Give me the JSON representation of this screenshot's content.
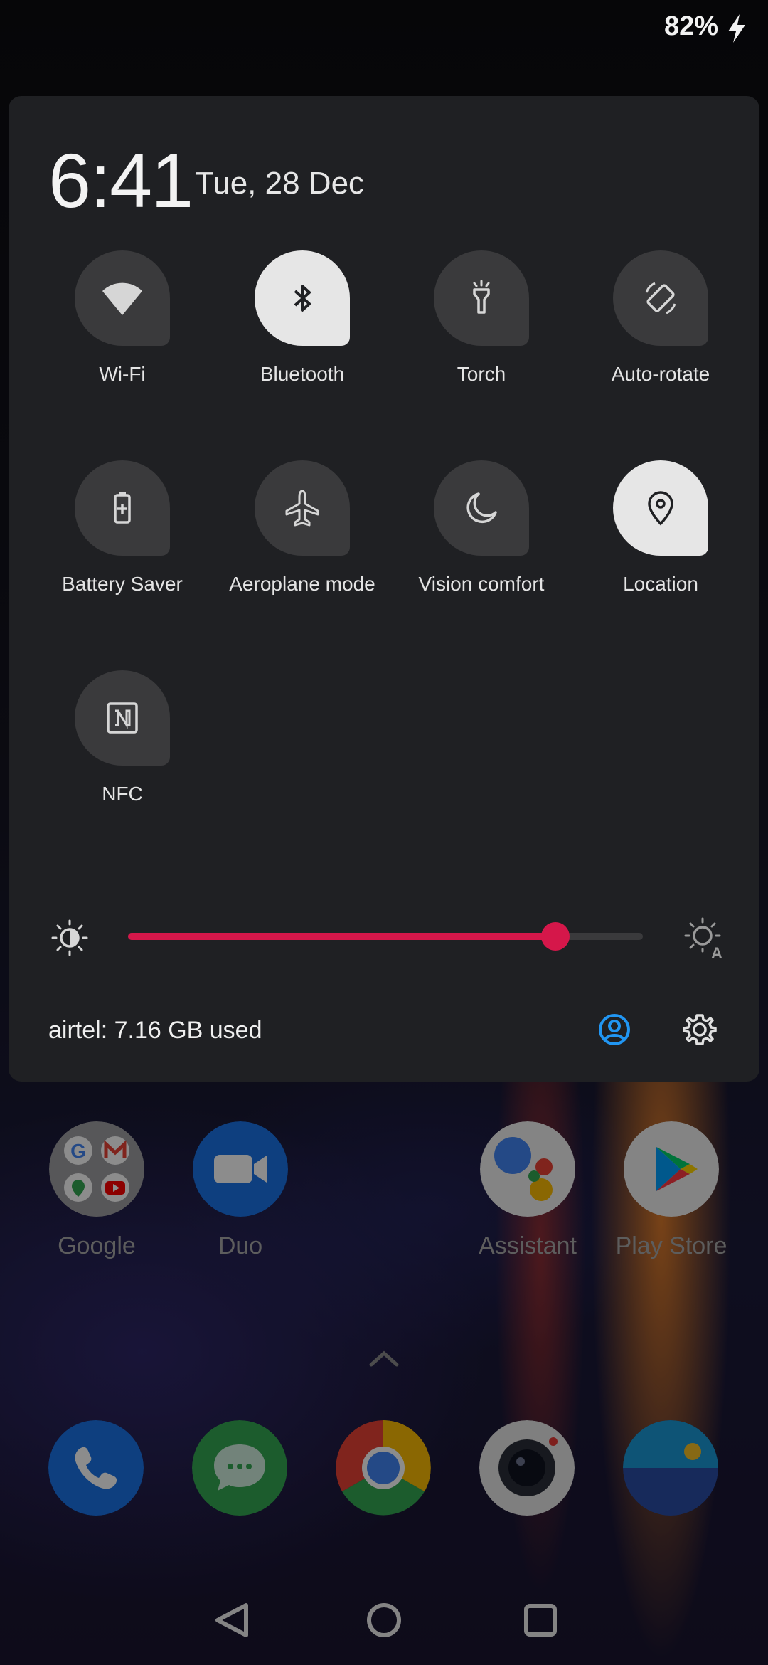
{
  "status_bar": {
    "battery": "82%"
  },
  "clock": {
    "time": "6:41",
    "date": "Tue, 28 Dec"
  },
  "tiles": [
    {
      "label": "Wi-Fi",
      "icon": "wifi-icon",
      "on": false
    },
    {
      "label": "Bluetooth",
      "icon": "bluetooth-icon",
      "on": true
    },
    {
      "label": "Torch",
      "icon": "torch-icon",
      "on": false
    },
    {
      "label": "Auto-rotate",
      "icon": "auto-rotate-icon",
      "on": false
    },
    {
      "label": "Battery Saver",
      "icon": "battery-saver-icon",
      "on": false
    },
    {
      "label": "Aeroplane mode",
      "icon": "airplane-icon",
      "on": false
    },
    {
      "label": "Vision comfort",
      "icon": "moon-icon",
      "on": false
    },
    {
      "label": "Location",
      "icon": "location-icon",
      "on": true
    },
    {
      "label": "NFC",
      "icon": "nfc-icon",
      "on": false
    }
  ],
  "brightness": {
    "level": 0.83,
    "accent": "#d5174a"
  },
  "footer": {
    "data_usage": "airtel: 7.16 GB used"
  },
  "home_apps": [
    {
      "name": "Google"
    },
    {
      "name": "Duo"
    },
    {
      "name": "Assistant"
    },
    {
      "name": "Play Store"
    }
  ],
  "dock": [
    "Phone",
    "Messages",
    "Chrome",
    "Camera",
    "Gallery"
  ],
  "accent_colors": {
    "user_icon": "#2196f3",
    "slider": "#d5174a"
  }
}
